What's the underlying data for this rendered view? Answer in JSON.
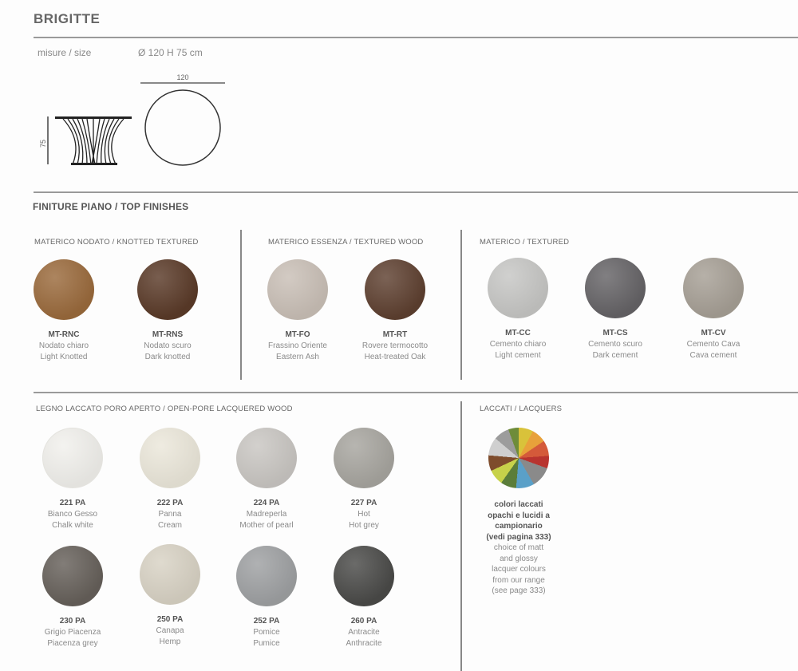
{
  "product": {
    "name": "BRIGITTE"
  },
  "size": {
    "label": "misure / size",
    "value": "Ø 120 H 75 cm"
  },
  "drawing": {
    "width_label": "120",
    "height_label": "75"
  },
  "top_finishes": {
    "title": "FINITURE PIANO / TOP FINISHES"
  },
  "groups": {
    "knotted": {
      "title": "MATERICO NODATO / KNOTTED TEXTURED",
      "items": [
        {
          "code": "MT-RNC",
          "it": "Nodato chiaro",
          "en": "Light Knotted",
          "color": "#9a6a3c"
        },
        {
          "code": "MT-RNS",
          "it": "Nodato scuro",
          "en": "Dark knotted",
          "color": "#5a3a28"
        }
      ]
    },
    "wood": {
      "title": "MATERICO ESSENZA / TEXTURED WOOD",
      "items": [
        {
          "code": "MT-FO",
          "it": "Frassino Oriente",
          "en": "Eastern Ash",
          "color": "#c9bfb6"
        },
        {
          "code": "MT-RT",
          "it": "Rovere termocotto",
          "en": "Heat-treated Oak",
          "color": "#5e4030"
        }
      ]
    },
    "textured": {
      "title": "MATERICO  / TEXTURED",
      "items": [
        {
          "code": "MT-CC",
          "it": "Cemento chiaro",
          "en": "Light cement",
          "color": "#c6c6c4"
        },
        {
          "code": "MT-CS",
          "it": "Cemento scuro",
          "en": "Dark cement",
          "color": "#656366"
        },
        {
          "code": "MT-CV",
          "it": "Cemento Cava",
          "en": "Cava cement",
          "color": "#a69f95"
        }
      ]
    },
    "open_pore": {
      "title": "LEGNO LACCATO PORO APERTO / OPEN-PORE LACQUERED WOOD",
      "items": [
        {
          "code": "221 PA",
          "it": "Bianco Gesso",
          "en": "Chalk white",
          "color": "#f1f0ec"
        },
        {
          "code": "222 PA",
          "it": "Panna",
          "en": "Cream",
          "color": "#ebe7da"
        },
        {
          "code": "224 PA",
          "it": "Madreperla",
          "en": "Mother of pearl",
          "color": "#c9c6c2"
        },
        {
          "code": "227 PA",
          "it": "Hot",
          "en": "Hot grey",
          "color": "#a7a59f"
        },
        {
          "code": "230 PA",
          "it": "Grigio Piacenza",
          "en": "Piacenza grey",
          "color": "#66605a"
        },
        {
          "code": "250 PA",
          "it": "Canapa",
          "en": "Hemp",
          "color": "#d8d2c4"
        },
        {
          "code": "252 PA",
          "it": "Pomice",
          "en": "Pumice",
          "color": "#9ea0a2"
        },
        {
          "code": "260 PA",
          "it": "Antracite",
          "en": "Anthracite",
          "color": "#4a4a48"
        }
      ]
    },
    "lacquers": {
      "title": "LACCATI / LACQUERS",
      "bold_lines": [
        "colori laccati",
        "opachi e lucidi a",
        "campionario",
        "(vedi pagina 333)"
      ],
      "light_lines": [
        "choice of matt",
        "and glossy",
        "lacquer colours",
        "from our range",
        "(see page 333)"
      ]
    }
  }
}
